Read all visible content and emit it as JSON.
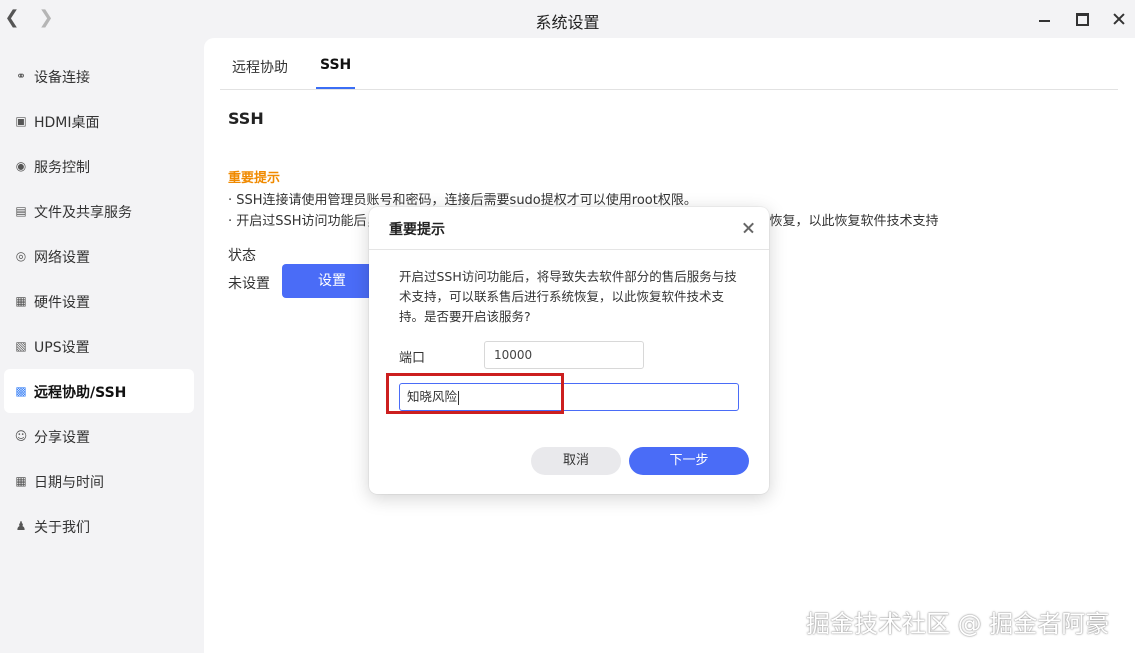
{
  "window": {
    "title": "系统设置"
  },
  "sidebar": {
    "items": [
      {
        "label": "设备连接",
        "icon": "link-icon"
      },
      {
        "label": "HDMI桌面",
        "icon": "monitor-icon"
      },
      {
        "label": "服务控制",
        "icon": "toggle-icon"
      },
      {
        "label": "文件及共享服务",
        "icon": "file-icon"
      },
      {
        "label": "网络设置",
        "icon": "globe-icon"
      },
      {
        "label": "硬件设置",
        "icon": "grid-icon"
      },
      {
        "label": "UPS设置",
        "icon": "battery-icon"
      },
      {
        "label": "远程协助/SSH",
        "icon": "remote-icon",
        "active": true
      },
      {
        "label": "分享设置",
        "icon": "share-icon"
      },
      {
        "label": "日期与时间",
        "icon": "calendar-icon"
      },
      {
        "label": "关于我们",
        "icon": "people-icon"
      }
    ]
  },
  "tabs": [
    {
      "label": "远程协助"
    },
    {
      "label": "SSH",
      "active": true
    }
  ],
  "main": {
    "section_title": "SSH",
    "notice_title": "重要提示",
    "notice_line1": "· SSH连接请使用管理员账号和密码，连接后需要sudo提权才可以使用root权限。",
    "notice_line2": "· 开启过SSH访问功能后，将导致失去软件部分的售后服务与技术支持，可以联系售后进行系统恢复，以此恢复软件技术支持",
    "status_label": "状态",
    "status_value": "未设置",
    "setup_button": "设置"
  },
  "dialog": {
    "title": "重要提示",
    "message": "开启过SSH访问功能后，将导致失去软件部分的售后服务与技术支持，可以联系售后进行系统恢复，以此恢复软件技术支持。是否要开启该服务?",
    "port_label": "端口",
    "port_value": "10000",
    "confirm_value": "知晓风险",
    "cancel_button": "取消",
    "next_button": "下一步"
  },
  "watermark": "掘金技术社区 @ 掘金者阿豪",
  "colors": {
    "accent": "#4a6cf7",
    "warning": "#f08a00",
    "highlight": "#cc1f1f"
  }
}
